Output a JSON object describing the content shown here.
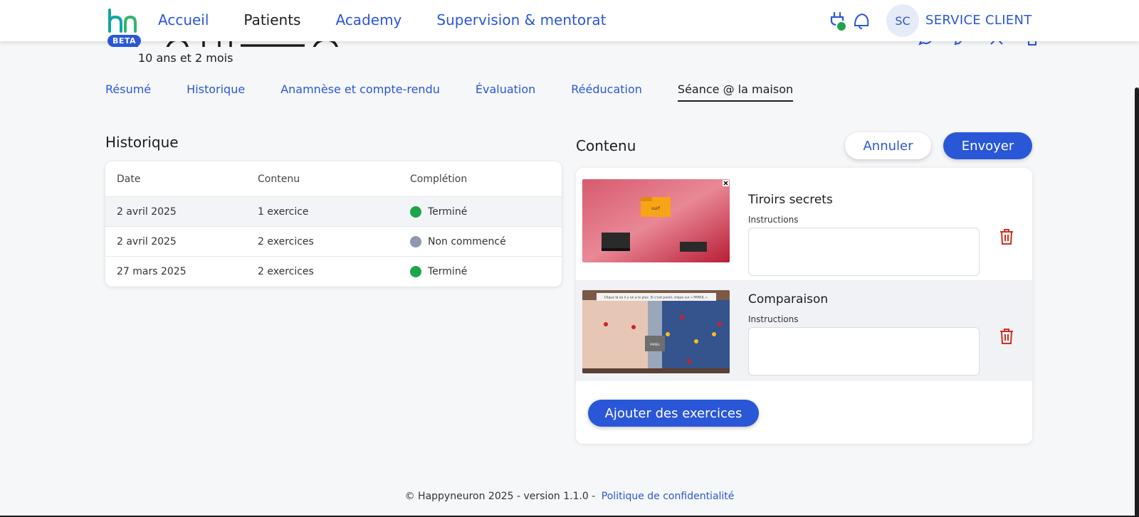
{
  "header": {
    "beta": "BETA",
    "nav": [
      "Accueil",
      "Patients",
      "Academy",
      "Supervision & mentorat"
    ],
    "active_nav": "Patients",
    "user_initials": "SC",
    "user_name": "SERVICE CLIENT",
    "status_color": "#1ea54a"
  },
  "patient": {
    "age": "10 ans et 2 mois"
  },
  "tabs": [
    "Résumé",
    "Historique",
    "Anamnèse et compte-rendu",
    "Évaluation",
    "Rééducation",
    "Séance @ la maison"
  ],
  "active_tab": "Séance @ la maison",
  "historique": {
    "title": "Historique",
    "columns": [
      "Date",
      "Contenu",
      "Complétion"
    ],
    "rows": [
      {
        "date": "2 avril 2025",
        "content": "1 exercice",
        "status": "Terminé",
        "status_color": "#1ea54a"
      },
      {
        "date": "2 avril 2025",
        "content": "2 exercices",
        "status": "Non commencé",
        "status_color": "#8e99ad"
      },
      {
        "date": "27 mars 2025",
        "content": "2 exercices",
        "status": "Terminé",
        "status_color": "#1ea54a"
      }
    ]
  },
  "contenu": {
    "title": "Contenu",
    "cancel_label": "Annuler",
    "send_label": "Envoyer",
    "add_label": "Ajouter des exercices",
    "exercises": [
      {
        "name": "Tiroirs secrets",
        "instructions_label": "Instructions",
        "instructions_value": "",
        "thumb_label": "surf"
      },
      {
        "name": "Comparaison",
        "instructions_label": "Instructions",
        "instructions_value": "",
        "thumb_label": "PAREIL",
        "thumb_caption": "Clique là où il y en a le plus. Si c'est pareil, clique sur « PAREIL »."
      }
    ]
  },
  "footer": {
    "text": "© Happyneuron 2025 - version 1.1.0 -",
    "link": "Politique de confidentialité"
  },
  "colors": {
    "accent": "#2a57d8",
    "danger": "#d0301e"
  }
}
